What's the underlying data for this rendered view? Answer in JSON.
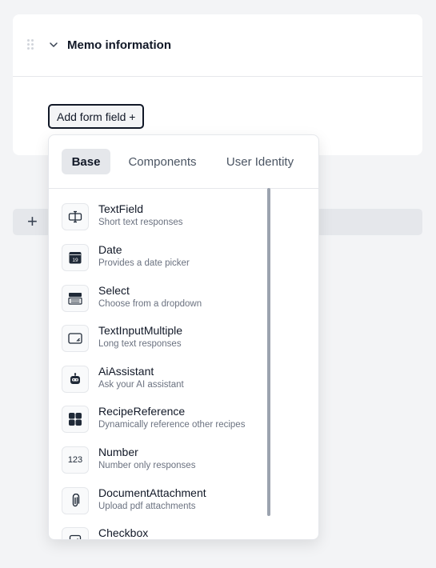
{
  "section": {
    "title": "Memo information"
  },
  "add_field_button": {
    "label": "Add form field +"
  },
  "add_bar": {
    "icon": "plus-icon",
    "label": "+"
  },
  "dropdown": {
    "tabs": [
      {
        "label": "Base",
        "active": true
      },
      {
        "label": "Components",
        "active": false
      },
      {
        "label": "User Identity",
        "active": false
      }
    ],
    "items": [
      {
        "title": "TextField",
        "description": "Short text responses",
        "icon": "textfield-icon"
      },
      {
        "title": "Date",
        "description": "Provides a date picker",
        "icon": "calendar-icon",
        "icon_text": "19"
      },
      {
        "title": "Select",
        "description": "Choose from a dropdown",
        "icon": "select-icon"
      },
      {
        "title": "TextInputMultiple",
        "description": "Long text responses",
        "icon": "textarea-icon"
      },
      {
        "title": "AiAssistant",
        "description": "Ask your AI assistant",
        "icon": "robot-icon"
      },
      {
        "title": "RecipeReference",
        "description": "Dynamically reference other recipes",
        "icon": "grid-icon"
      },
      {
        "title": "Number",
        "description": "Number only responses",
        "icon": "number-icon",
        "icon_text": "123"
      },
      {
        "title": "DocumentAttachment",
        "description": "Upload pdf attachments",
        "icon": "paperclip-icon"
      },
      {
        "title": "Checkbox",
        "description": "",
        "icon": "checkbox-icon"
      }
    ]
  }
}
